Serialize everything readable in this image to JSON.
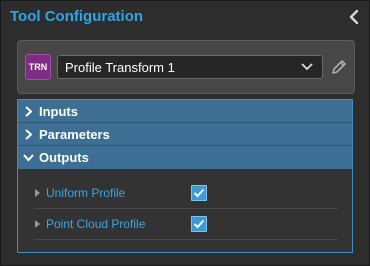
{
  "panel": {
    "title": "Tool Configuration"
  },
  "tool": {
    "badge": "TRN",
    "selected": "Profile Transform 1"
  },
  "sections": [
    {
      "label": "Inputs",
      "expanded": false
    },
    {
      "label": "Parameters",
      "expanded": false
    },
    {
      "label": "Outputs",
      "expanded": true
    }
  ],
  "outputs": [
    {
      "label": "Uniform Profile",
      "checked": true
    },
    {
      "label": "Point Cloud Profile",
      "checked": true
    }
  ],
  "colors": {
    "accent": "#2ea6e6",
    "header": "#3c6f93",
    "badge": "#7d2d84"
  }
}
